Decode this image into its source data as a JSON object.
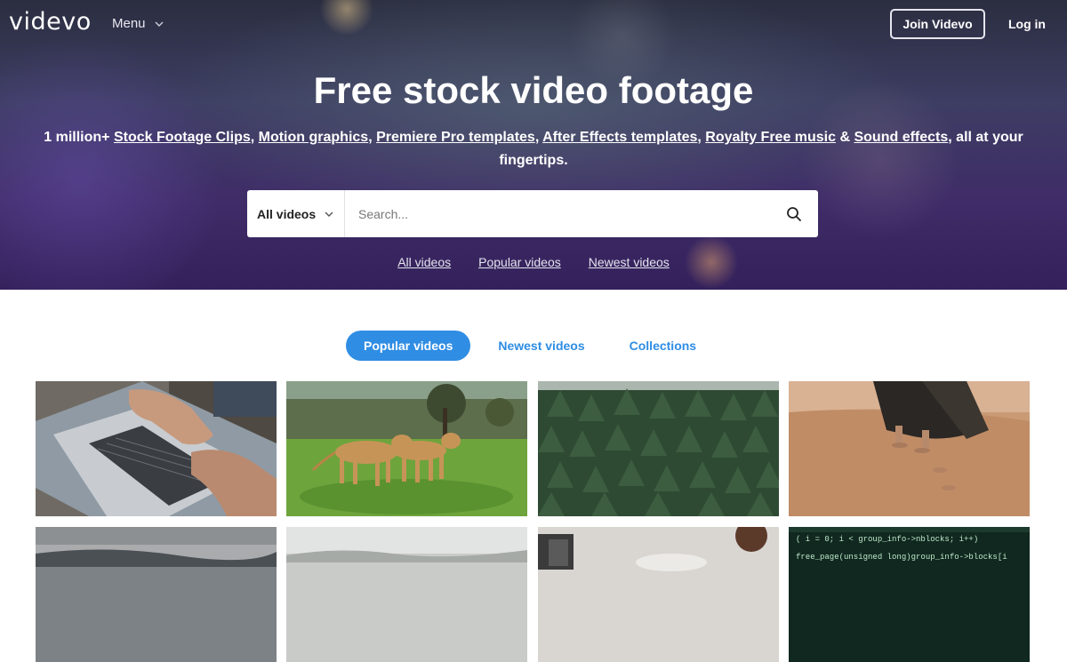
{
  "nav": {
    "logo": "videvo",
    "menu_label": "Menu",
    "join_label": "Join Videvo",
    "login_label": "Log in"
  },
  "hero": {
    "title": "Free stock video footage",
    "sub_prefix": "1 million+ ",
    "links": [
      "Stock Footage Clips",
      "Motion graphics",
      "Premiere Pro templates",
      "After Effects templates",
      "Royalty Free music",
      "Sound effects"
    ],
    "sep_comma": ", ",
    "sep_amp": " & ",
    "sub_suffix": ", all at your fingertips."
  },
  "search": {
    "category": "All videos",
    "placeholder": "Search..."
  },
  "quick_links": [
    "All videos",
    "Popular videos",
    "Newest videos"
  ],
  "tabs": [
    "Popular videos",
    "Newest videos",
    "Collections"
  ],
  "active_tab": 0,
  "thumbnails": [
    {
      "scene": "laptop-typing"
    },
    {
      "scene": "lionesses-walking"
    },
    {
      "scene": "pine-forest-aerial"
    },
    {
      "scene": "desert-walk"
    },
    {
      "scene": "cloudy-lake"
    },
    {
      "scene": "misty-field"
    },
    {
      "scene": "coffee-table"
    },
    {
      "scene": "code-screen"
    }
  ],
  "code_lines": [
    "( i = 0; i < group_info->nblocks; i++)",
    "free_page(unsigned long)group_info->blocks[i"
  ],
  "colors": {
    "accent": "#2f8de4",
    "hero_bg": "#3d2c66"
  }
}
